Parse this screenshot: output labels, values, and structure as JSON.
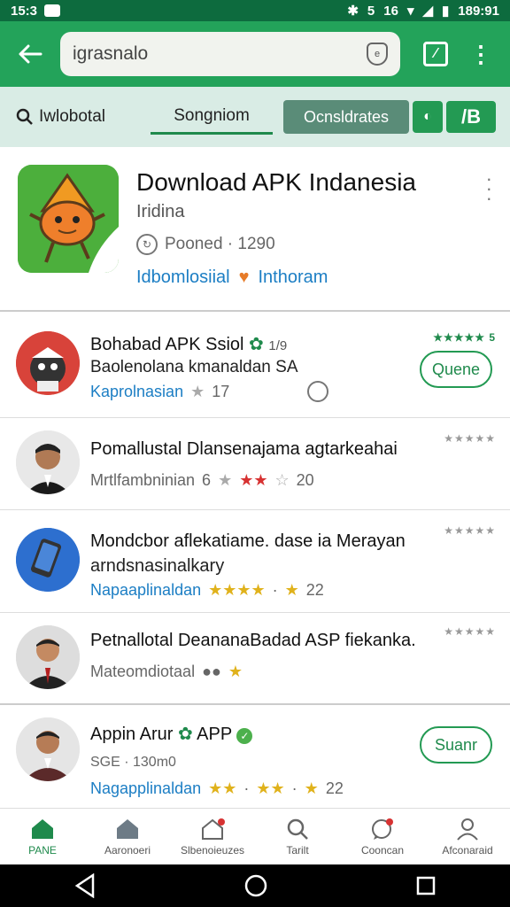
{
  "status_bar": {
    "left_time": "15:3",
    "right_time": "189:91",
    "net": "16",
    "batt": "5"
  },
  "search": {
    "value": "igrasnalo"
  },
  "tabs": {
    "search": "Iwlobotal",
    "active": "Songniom",
    "pill": "Ocnsldrates",
    "square1": "O",
    "square2": "/B"
  },
  "hero": {
    "title": "Download APK Indanesia",
    "subtitle": "Iridina",
    "meta": "Pooned · 1290",
    "link1": "Idbomlosiial",
    "link2": "Inthoram"
  },
  "rows": [
    {
      "title": "Bohabad APK Ssiol",
      "title_suffix": "1/9",
      "line": "Baolenolana kmanaldan  SA",
      "meta_blue": "Kaprolnasian",
      "meta_num": "17",
      "stars": "★★★★★ 5",
      "button": "Quene"
    },
    {
      "title": "Pomallustal Dlansenajama agtarkeahai",
      "meta": "Mrtlfambninian",
      "meta_num": "6",
      "meta_end": "20",
      "stars": "★★★★★"
    },
    {
      "title": "Mondcbor aflekatiame. dase ia Merayan",
      "line": "arndsnasinalkary",
      "meta_blue": "Napaaplinaldan",
      "meta_num": "22",
      "stars": "★★★★★"
    },
    {
      "title": "Petnallotal DeananaBadad ASP fiekanka.",
      "meta": "Mateomdiotaal",
      "stars": "★★★★★"
    },
    {
      "title": "Appin Arur",
      "title_suffix": "APP",
      "meta": "SGE · 130m0",
      "meta_blue": "Nagapplinaldan",
      "meta_num": "22",
      "button": "Suanr"
    }
  ],
  "nav": [
    {
      "label": "PANE"
    },
    {
      "label": "Aaronoeri"
    },
    {
      "label": "Slbenoieuzes"
    },
    {
      "label": "Tarilt"
    },
    {
      "label": "Cooncan"
    },
    {
      "label": "Afconaraid"
    }
  ],
  "colors": {
    "primary": "#23a35a",
    "dark": "#0d6b3e",
    "link": "#1c7ec4"
  }
}
